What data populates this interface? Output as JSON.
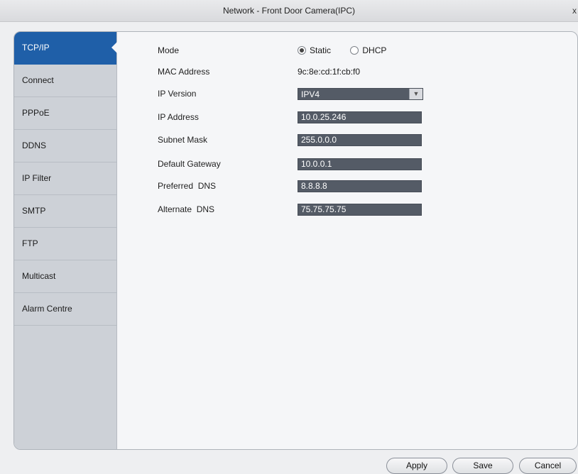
{
  "window": {
    "title": "Network - Front Door Camera(IPC)",
    "close_glyph": "x"
  },
  "sidebar": {
    "items": [
      {
        "label": "TCP/IP",
        "active": true
      },
      {
        "label": "Connect"
      },
      {
        "label": "PPPoE"
      },
      {
        "label": "DDNS"
      },
      {
        "label": "IP Filter"
      },
      {
        "label": "SMTP"
      },
      {
        "label": "FTP"
      },
      {
        "label": "Multicast"
      },
      {
        "label": "Alarm Centre"
      }
    ]
  },
  "form": {
    "mode": {
      "label": "Mode",
      "options": [
        "Static",
        "DHCP"
      ],
      "selected": "Static"
    },
    "mac": {
      "label": "MAC Address",
      "value": "9c:8e:cd:1f:cb:f0"
    },
    "ip_version": {
      "label": "IP Version",
      "value": "IPV4"
    },
    "ip_address": {
      "label": "IP Address",
      "value": "10.0.25.246"
    },
    "subnet_mask": {
      "label": "Subnet Mask",
      "value": "255.0.0.0"
    },
    "default_gateway": {
      "label": "Default Gateway",
      "value": "10.0.0.1"
    },
    "preferred_dns": {
      "label": "Preferred  DNS",
      "value": "8.8.8.8"
    },
    "alternate_dns": {
      "label": "Alternate  DNS",
      "value": "75.75.75.75"
    }
  },
  "buttons": {
    "apply": "Apply",
    "save": "Save",
    "cancel": "Cancel"
  },
  "colors": {
    "accent": "#1f5fa8",
    "field_bg": "#545b66",
    "sidebar_bg": "#cdd1d7"
  }
}
